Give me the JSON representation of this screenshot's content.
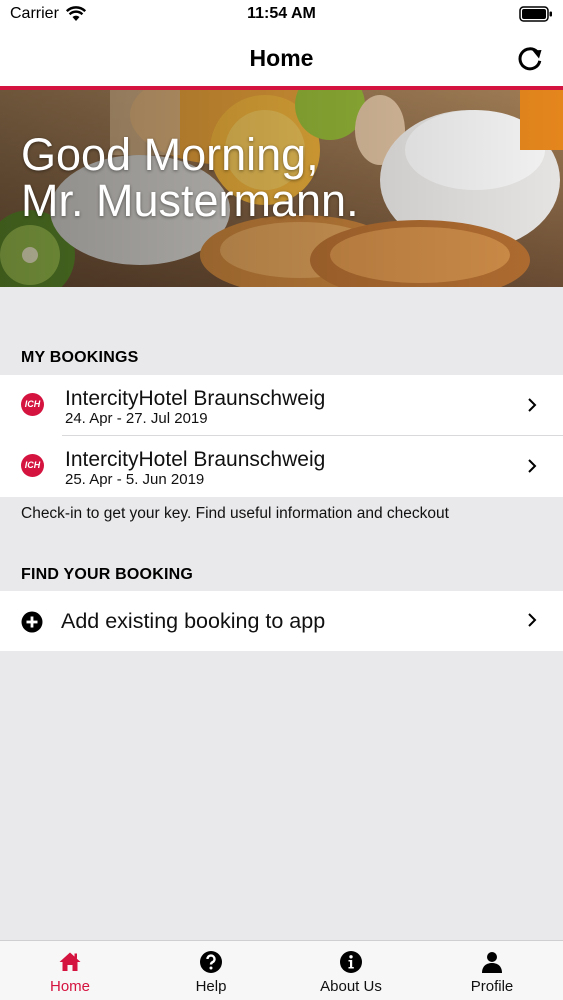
{
  "status_bar": {
    "carrier": "Carrier",
    "time": "11:54 AM"
  },
  "nav": {
    "title": "Home",
    "refresh_icon": "refresh-icon"
  },
  "hero": {
    "greeting_line1": "Good Morning,",
    "greeting_line2": "Mr. Mustermann."
  },
  "my_bookings": {
    "header": "MY BOOKINGS",
    "items": [
      {
        "logo": "ICH",
        "hotel": "IntercityHotel Braunschweig",
        "dates": "24. Apr - 27. Jul 2019"
      },
      {
        "logo": "ICH",
        "hotel": "IntercityHotel Braunschweig",
        "dates": "25. Apr - 5. Jun 2019"
      }
    ],
    "note": "Check-in to get your key. Find useful information and checkout"
  },
  "find_booking": {
    "header": "FIND YOUR BOOKING",
    "add_label": "Add existing booking to app"
  },
  "tabs": [
    {
      "label": "Home",
      "icon": "home-icon",
      "active": true
    },
    {
      "label": "Help",
      "icon": "help-icon",
      "active": false
    },
    {
      "label": "About Us",
      "icon": "info-icon",
      "active": false
    },
    {
      "label": "Profile",
      "icon": "profile-icon",
      "active": false
    }
  ],
  "colors": {
    "accent": "#d5133f",
    "background": "#e9e9eb",
    "surface": "#ffffff"
  }
}
